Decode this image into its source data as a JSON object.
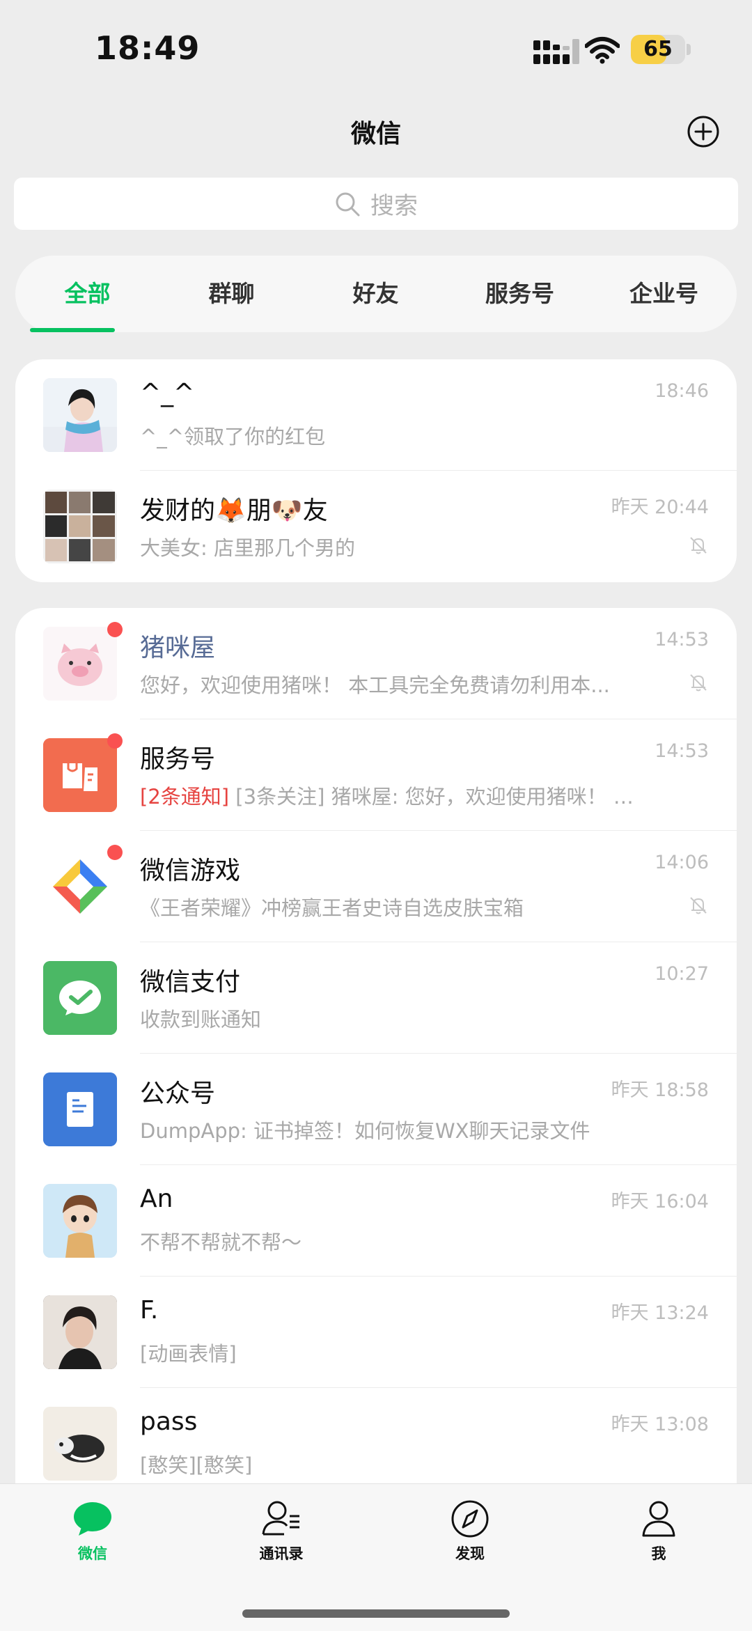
{
  "status": {
    "time": "18:49",
    "battery": "65",
    "battery_level": 0.65
  },
  "header": {
    "title": "微信"
  },
  "search": {
    "placeholder": "搜索"
  },
  "tabs": [
    {
      "label": "全部",
      "active": true
    },
    {
      "label": "群聊"
    },
    {
      "label": "好友"
    },
    {
      "label": "服务号"
    },
    {
      "label": "企业号"
    }
  ],
  "pinned": [
    {
      "name": "^_^",
      "message": "^_^领取了你的红包",
      "time": "18:46",
      "muted": false
    },
    {
      "name_parts": [
        "发财的",
        "🦊",
        "朋",
        "🐶",
        "友"
      ],
      "message": "大美女: 店里那几个男的",
      "time": "昨天 20:44",
      "muted": true
    }
  ],
  "chats": [
    {
      "name": "猪咪屋",
      "message": "您好，欢迎使用猪咪！ 本工具完全免费请勿利用本...",
      "time": "14:53",
      "muted": true,
      "unread": true
    },
    {
      "name": "服务号",
      "message_highlight": "[2条通知]",
      "message": " [3条关注] 猪咪屋: 您好，欢迎使用猪咪！ 本...",
      "time": "14:53",
      "muted": false,
      "unread": true
    },
    {
      "name": "微信游戏",
      "message": "《王者荣耀》冲榜赢王者史诗自选皮肤宝箱",
      "time": "14:06",
      "muted": true,
      "unread": true
    },
    {
      "name": "微信支付",
      "message": "收款到账通知",
      "time": "10:27",
      "muted": false,
      "unread": false
    },
    {
      "name": "公众号",
      "message": "DumpApp: 证书掉签！如何恢复WX聊天记录文件",
      "time": "昨天 18:58",
      "muted": false,
      "unread": false
    },
    {
      "name": "An",
      "message": "不帮不帮就不帮～",
      "time": "昨天 16:04",
      "muted": false,
      "unread": false
    },
    {
      "name": "F.",
      "message": "[动画表情]",
      "time": "昨天 13:24",
      "muted": false,
      "unread": false
    },
    {
      "name": "pass",
      "message": "[憨笑][憨笑]",
      "time": "昨天 13:08",
      "muted": false,
      "unread": false
    }
  ],
  "tabbar": [
    {
      "label": "微信",
      "icon": "chat-bubble-icon",
      "active": true
    },
    {
      "label": "通讯录",
      "icon": "contacts-icon"
    },
    {
      "label": "发现",
      "icon": "compass-icon"
    },
    {
      "label": "我",
      "icon": "person-icon"
    }
  ],
  "colors": {
    "accent": "#07c160",
    "unread_dot": "#fa5151",
    "notice_red": "#e64340",
    "service_name_blue": "#576b95",
    "background": "#ededed"
  }
}
